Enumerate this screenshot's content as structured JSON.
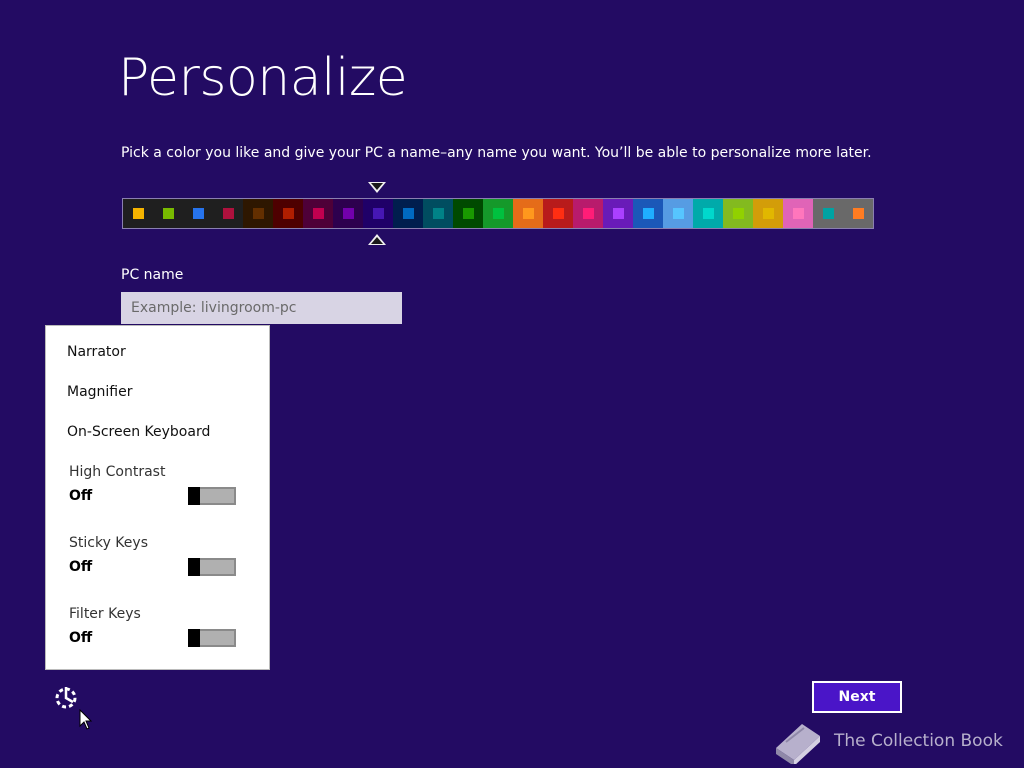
{
  "page": {
    "title": "Personalize",
    "subtitle": "Pick a color you like and give your PC a name–any name you want. You’ll be able to personalize more later."
  },
  "palette": {
    "selected_index": 8,
    "swatches": [
      {
        "bg": "#1f1f1f",
        "chip": "#f4b300"
      },
      {
        "bg": "#1f1f1f",
        "chip": "#78ba00"
      },
      {
        "bg": "#1f1f1f",
        "chip": "#2673ec"
      },
      {
        "bg": "#1f1f1f",
        "chip": "#ae113d"
      },
      {
        "bg": "#2e1700",
        "chip": "#632f00"
      },
      {
        "bg": "#4e0000",
        "chip": "#b01e00"
      },
      {
        "bg": "#4e0038",
        "chip": "#c1004f"
      },
      {
        "bg": "#2d004e",
        "chip": "#7200ac"
      },
      {
        "bg": "#1f0068",
        "chip": "#4617b4"
      },
      {
        "bg": "#001e4e",
        "chip": "#006ac1"
      },
      {
        "bg": "#004d60",
        "chip": "#008287"
      },
      {
        "bg": "#004a00",
        "chip": "#199900"
      },
      {
        "bg": "#15992a",
        "chip": "#00c13f"
      },
      {
        "bg": "#e56c19",
        "chip": "#ff981d"
      },
      {
        "bg": "#b81b1b",
        "chip": "#ff2e12"
      },
      {
        "bg": "#b81b6c",
        "chip": "#ff1d77"
      },
      {
        "bg": "#691bb8",
        "chip": "#aa40ff"
      },
      {
        "bg": "#1b58b8",
        "chip": "#1faeff"
      },
      {
        "bg": "#569ce3",
        "chip": "#56c5ff"
      },
      {
        "bg": "#00aaaa",
        "chip": "#00d8cc"
      },
      {
        "bg": "#83ba1f",
        "chip": "#91d100"
      },
      {
        "bg": "#d39d09",
        "chip": "#e1b700"
      },
      {
        "bg": "#e064b7",
        "chip": "#ff76bc"
      },
      {
        "bg": "#696969",
        "chip": "#00a3a3"
      },
      {
        "bg": "#696969",
        "chip": "#fe7c22"
      }
    ]
  },
  "pc_name": {
    "label": "PC name",
    "placeholder": "Example: livingroom-pc",
    "value": ""
  },
  "ease_of_access": {
    "links": [
      "Narrator",
      "Magnifier",
      "On-Screen Keyboard"
    ],
    "toggles": [
      {
        "title": "High Contrast",
        "state": "Off"
      },
      {
        "title": "Sticky Keys",
        "state": "Off"
      },
      {
        "title": "Filter Keys",
        "state": "Off"
      }
    ]
  },
  "footer": {
    "next_label": "Next",
    "watermark": "The Collection Book"
  }
}
